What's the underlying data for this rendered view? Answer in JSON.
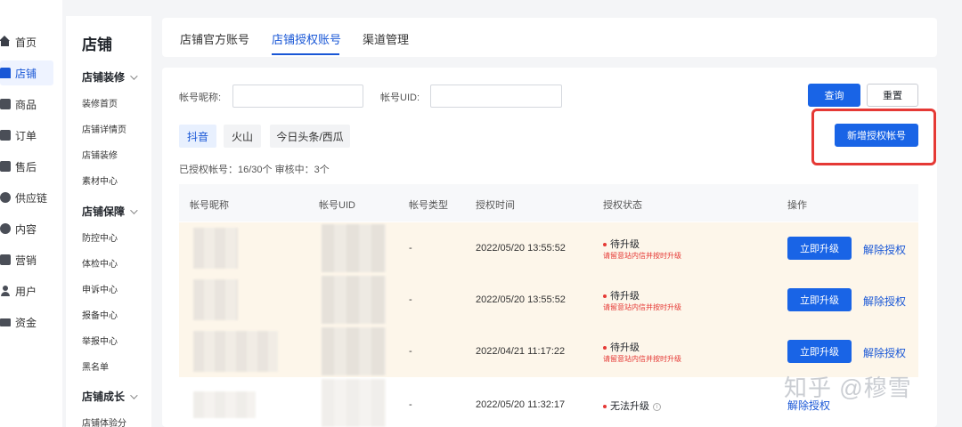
{
  "nav": {
    "items": [
      {
        "label": "首页",
        "icon": "home-icon"
      },
      {
        "label": "店铺",
        "icon": "shop-icon",
        "active": true
      },
      {
        "label": "商品",
        "icon": "product-icon"
      },
      {
        "label": "订单",
        "icon": "order-icon"
      },
      {
        "label": "售后",
        "icon": "aftersale-icon"
      },
      {
        "label": "供应链",
        "icon": "supply-chain-icon"
      },
      {
        "label": "内容",
        "icon": "content-icon"
      },
      {
        "label": "营销",
        "icon": "marketing-icon"
      },
      {
        "label": "用户",
        "icon": "user-icon"
      },
      {
        "label": "资金",
        "icon": "wallet-icon"
      }
    ]
  },
  "subnav": {
    "title": "店铺",
    "sections": [
      {
        "title": "店铺装修",
        "items": [
          "装修首页",
          "店铺详情页",
          "店铺装修",
          "素材中心"
        ]
      },
      {
        "title": "店铺保障",
        "items": [
          "防控中心",
          "体检中心",
          "申诉中心",
          "报备中心",
          "举报中心",
          "黑名单"
        ]
      },
      {
        "title": "店铺成长",
        "items": [
          "店铺体验分"
        ]
      }
    ]
  },
  "tabs": {
    "items": [
      "店铺官方账号",
      "店铺授权账号",
      "渠道管理"
    ],
    "active_index": 1
  },
  "filters": {
    "nickname_label": "帐号昵称:",
    "nickname_value": "",
    "uid_label": "帐号UID:",
    "uid_value": "",
    "query_label": "查询",
    "reset_label": "重置",
    "add_label": "新增授权帐号"
  },
  "platforms": {
    "items": [
      "抖音",
      "火山",
      "今日头条/西瓜"
    ],
    "active_index": 0
  },
  "summary": "已授权帐号：16/30个    审核中：3个",
  "table": {
    "headers": [
      "帐号昵称",
      "帐号UID",
      "帐号类型",
      "授权时间",
      "授权状态",
      "操作"
    ],
    "rows": [
      {
        "type": "-",
        "time": "2022/05/20 13:55:52",
        "status": "待升级",
        "note": "请留意站内信并按时升级",
        "upgrade": "立即升级",
        "revoke": "解除授权"
      },
      {
        "type": "-",
        "time": "2022/05/20 13:55:52",
        "status": "待升级",
        "note": "请留意站内信并按时升级",
        "upgrade": "立即升级",
        "revoke": "解除授权"
      },
      {
        "type": "-",
        "time": "2022/04/21 11:17:22",
        "status": "待升级",
        "note": "请留意站内信并按时升级",
        "upgrade": "立即升级",
        "revoke": "解除授权"
      },
      {
        "type": "-",
        "time": "2022/05/20 11:32:17",
        "status": "无法升级",
        "revoke": "解除授权"
      }
    ]
  },
  "watermark": "知乎 @穆雪",
  "colors": {
    "accent": "#1964e6",
    "highlight": "#e53935",
    "pending_row": "#fdf6ea"
  }
}
